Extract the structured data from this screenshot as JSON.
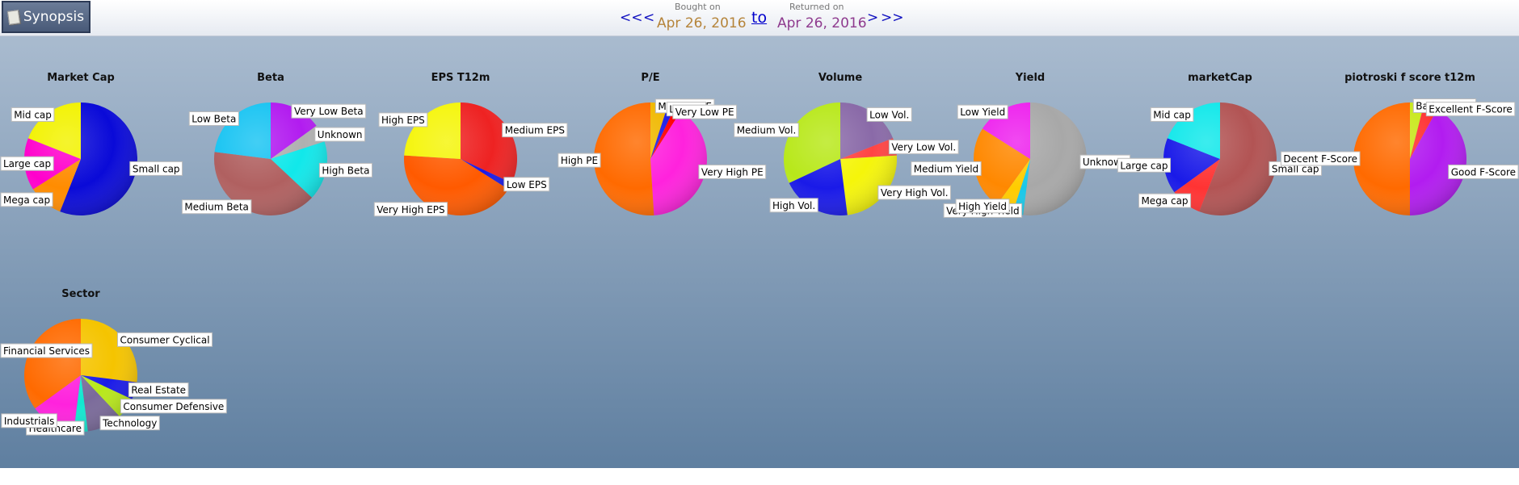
{
  "header": {
    "synopsis_label": "Synopsis",
    "nav_first": "<<",
    "nav_prev": "<",
    "nav_next": ">",
    "nav_last": ">>",
    "bought_caption": "Bought on",
    "bought_date": "Apr 26, 2016",
    "to_label": "to",
    "returned_caption": "Returned on",
    "returned_date": "Apr 26, 2016",
    "bought_color": "#b5843a",
    "returned_color": "#8e3a8e"
  },
  "chart_data": [
    {
      "type": "pie",
      "title": "Market Cap",
      "slices": [
        {
          "label": "Small cap",
          "value": 56,
          "color": "#0a0ad8"
        },
        {
          "label": "Mega cap",
          "value": 10,
          "color": "#ff8c00"
        },
        {
          "label": "Large cap",
          "value": 15,
          "color": "#ff00cc"
        },
        {
          "label": "Mid cap",
          "value": 19,
          "color": "#f2f200"
        }
      ]
    },
    {
      "type": "pie",
      "title": "Beta",
      "slices": [
        {
          "label": "Very Low Beta",
          "value": 15,
          "color": "#b21cf0"
        },
        {
          "label": "Unknown",
          "value": 5,
          "color": "#b0b0b0"
        },
        {
          "label": "High Beta",
          "value": 17,
          "color": "#11e8ea"
        },
        {
          "label": "Medium Beta",
          "value": 40,
          "color": "#b06060"
        },
        {
          "label": "Low Beta",
          "value": 23,
          "color": "#19c4f2"
        }
      ]
    },
    {
      "type": "pie",
      "title": "EPS T12m",
      "slices": [
        {
          "label": "Medium EPS",
          "value": 32,
          "color": "#ee2222"
        },
        {
          "label": "Low EPS",
          "value": 2,
          "color": "#1a1ae8"
        },
        {
          "label": "Very High EPS",
          "value": 42,
          "color": "#ff5a00"
        },
        {
          "label": "High EPS",
          "value": 24,
          "color": "#f5f50a"
        }
      ]
    },
    {
      "type": "pie",
      "title": "P/E",
      "slices": [
        {
          "label": "Medium PE",
          "value": 5,
          "color": "#f0b800"
        },
        {
          "label": "Low PE",
          "value": 2,
          "color": "#1a1ae8"
        },
        {
          "label": "Very Low PE",
          "value": 2,
          "color": "#ff0000"
        },
        {
          "label": "Very High PE",
          "value": 40,
          "color": "#ff22dd"
        },
        {
          "label": "High PE",
          "value": 51,
          "color": "#ff6a00"
        }
      ]
    },
    {
      "type": "pie",
      "title": "Volume",
      "slices": [
        {
          "label": "Low Vol.",
          "value": 19,
          "color": "#8a6aa8"
        },
        {
          "label": "Very Low Vol.",
          "value": 5,
          "color": "#ff4444"
        },
        {
          "label": "Very High Vol.",
          "value": 24,
          "color": "#f5f50a"
        },
        {
          "label": "High Vol.",
          "value": 20,
          "color": "#1a1ae8"
        },
        {
          "label": "Medium Vol.",
          "value": 32,
          "color": "#b8e81a"
        }
      ]
    },
    {
      "type": "pie",
      "title": "Yield",
      "slices": [
        {
          "label": "Unknown",
          "value": 52,
          "color": "#a8a8a8"
        },
        {
          "label": "Very High Yield",
          "value": 3,
          "color": "#1ac8e8"
        },
        {
          "label": "High Yield",
          "value": 5,
          "color": "#ffcc00"
        },
        {
          "label": "Medium Yield",
          "value": 24,
          "color": "#ff8800"
        },
        {
          "label": "Low Yield",
          "value": 16,
          "color": "#ee22ee"
        }
      ]
    },
    {
      "type": "pie",
      "title": "marketCap",
      "slices": [
        {
          "label": "Small cap",
          "value": 56,
          "color": "#b25454"
        },
        {
          "label": "Mega cap",
          "value": 9,
          "color": "#ff3333"
        },
        {
          "label": "Large cap",
          "value": 16,
          "color": "#1a1ae8"
        },
        {
          "label": "Mid cap",
          "value": 19,
          "color": "#11e8ea"
        }
      ]
    },
    {
      "type": "pie",
      "title": "piotroski f score t12m",
      "slices": [
        {
          "label": "Bad F Score",
          "value": 4,
          "color": "#c8e81a"
        },
        {
          "label": "Excellent F-Score",
          "value": 4,
          "color": "#ff3333"
        },
        {
          "label": "Good F-Score",
          "value": 42,
          "color": "#b21cf0"
        },
        {
          "label": "Decent F-Score",
          "value": 50,
          "color": "#ff6a00"
        }
      ]
    },
    {
      "type": "pie",
      "title": "Sector",
      "slices": [
        {
          "label": "Consumer Cyclical",
          "value": 27,
          "color": "#f5c400"
        },
        {
          "label": "Real Estate",
          "value": 5,
          "color": "#1a1ae8"
        },
        {
          "label": "Consumer Defensive",
          "value": 6,
          "color": "#b8e81a"
        },
        {
          "label": "Technology",
          "value": 10,
          "color": "#7a6a9a"
        },
        {
          "label": "Healthcare",
          "value": 4,
          "color": "#11e8d0"
        },
        {
          "label": "Industrials",
          "value": 13,
          "color": "#ff22dd"
        },
        {
          "label": "Financial Services",
          "value": 35,
          "color": "#ff6a00"
        }
      ]
    }
  ]
}
